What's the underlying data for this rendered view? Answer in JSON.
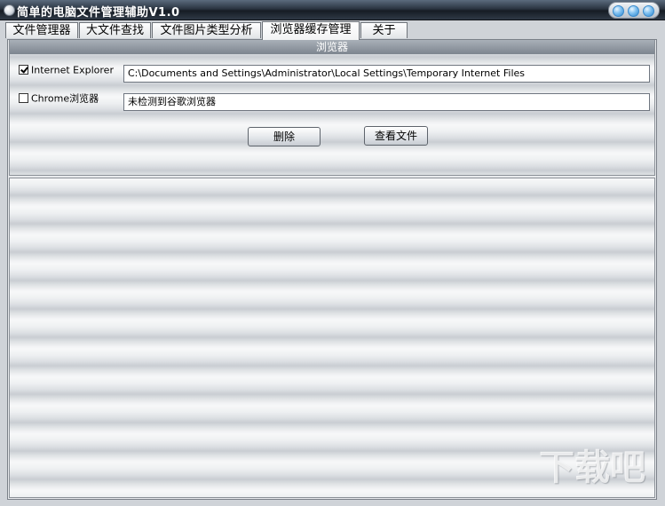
{
  "window": {
    "title": "简单的电脑文件管理辅助V1.0"
  },
  "tabs": [
    {
      "label": "文件管理器"
    },
    {
      "label": "大文件查找"
    },
    {
      "label": "文件图片类型分析"
    },
    {
      "label": "浏览器缓存管理",
      "active": true
    },
    {
      "label": "关于"
    }
  ],
  "browser_group": {
    "header": "浏览器",
    "ie": {
      "label": "Internet Explorer",
      "checked": true,
      "path": "C:\\Documents and Settings\\Administrator\\Local Settings\\Temporary Internet Files"
    },
    "chrome": {
      "label": "Chrome浏览器",
      "checked": false,
      "path": "未检测到谷歌浏览器"
    }
  },
  "buttons": {
    "delete_label": "删除",
    "view_files_label": "查看文件"
  },
  "watermark": {
    "text": "下载吧"
  },
  "icons": {
    "window": [
      "app-icon",
      "minimize-icon",
      "maximize-icon",
      "close-icon"
    ],
    "checkbox": "checkmark-icon"
  },
  "colors": {
    "titlebar": "#161c24",
    "control_buttons": "#2d86cf",
    "group_header": "#7d858f"
  }
}
